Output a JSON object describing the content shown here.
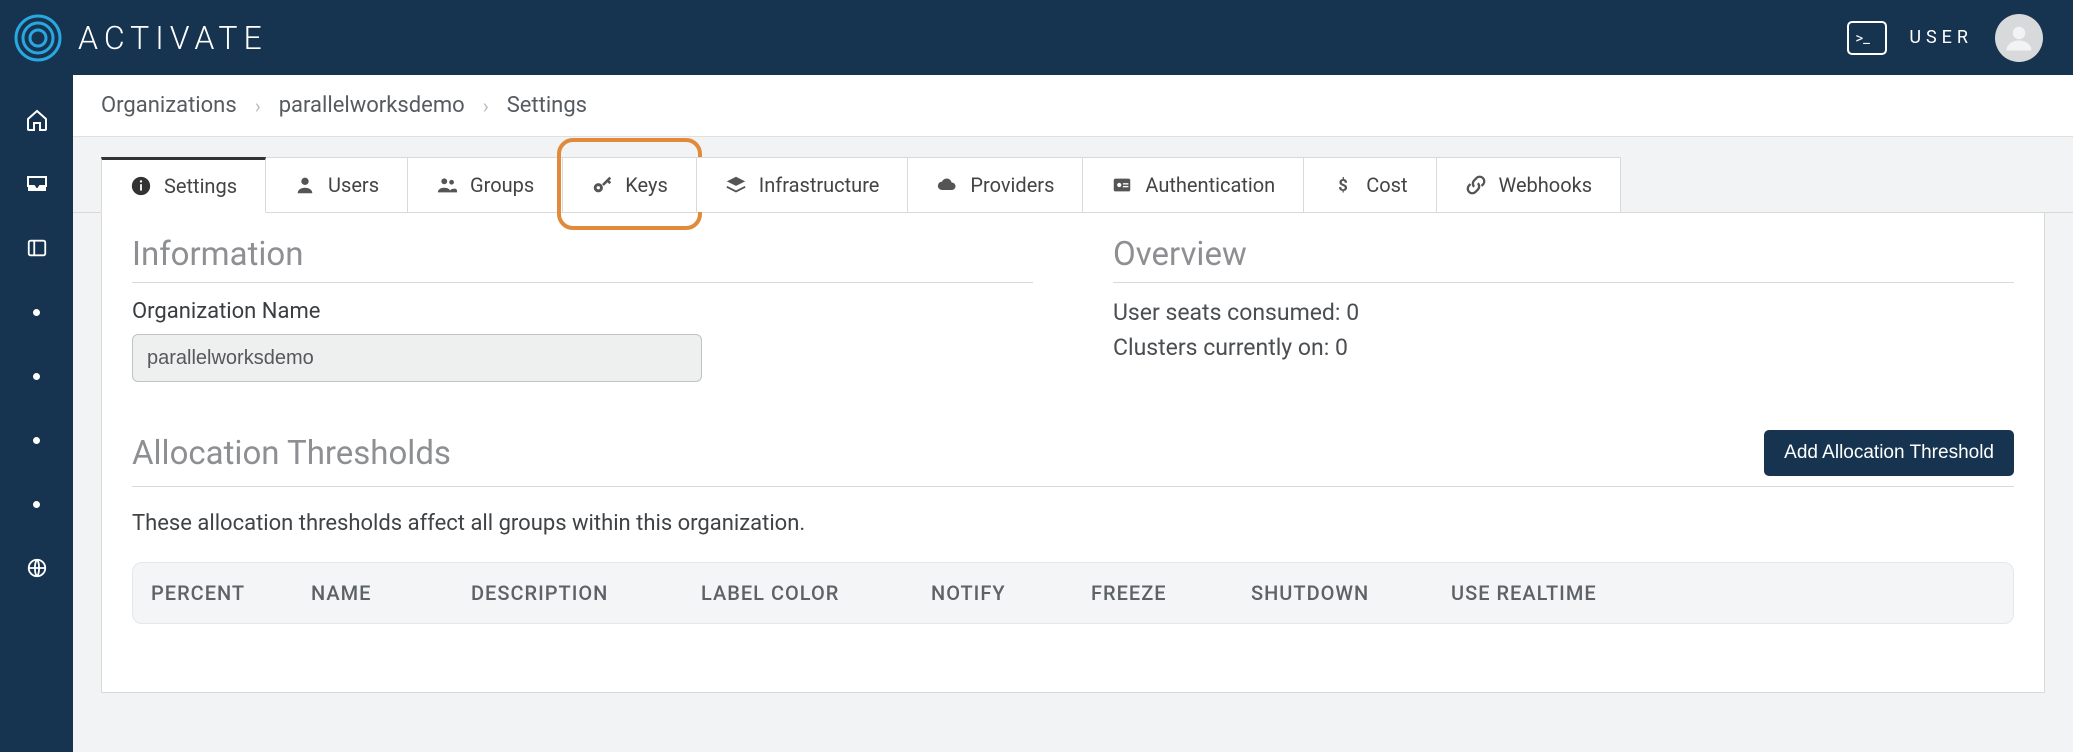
{
  "brand": {
    "name": "ACTIVATE"
  },
  "topbar": {
    "user_label": "USER",
    "terminal_glyph": ">_"
  },
  "breadcrumb": {
    "items": [
      "Organizations",
      "parallelworksdemo",
      "Settings"
    ]
  },
  "tabs": [
    {
      "label": "Settings",
      "icon": "info"
    },
    {
      "label": "Users",
      "icon": "user"
    },
    {
      "label": "Groups",
      "icon": "group"
    },
    {
      "label": "Keys",
      "icon": "key"
    },
    {
      "label": "Infrastructure",
      "icon": "layers"
    },
    {
      "label": "Providers",
      "icon": "cloud"
    },
    {
      "label": "Authentication",
      "icon": "badge"
    },
    {
      "label": "Cost",
      "icon": "dollar"
    },
    {
      "label": "Webhooks",
      "icon": "link"
    }
  ],
  "active_tab_index": 0,
  "highlighted_tab_index": 3,
  "info": {
    "heading": "Information",
    "org_name_label": "Organization Name",
    "org_name_value": "parallelworksdemo"
  },
  "overview": {
    "heading": "Overview",
    "seats_label": "User seats consumed:",
    "seats_value": "0",
    "clusters_label": "Clusters currently on:",
    "clusters_value": "0"
  },
  "alloc": {
    "heading": "Allocation Thresholds",
    "add_button": "Add Allocation Threshold",
    "description": "These allocation thresholds affect all groups within this organization.",
    "columns": [
      "PERCENT",
      "NAME",
      "DESCRIPTION",
      "LABEL COLOR",
      "NOTIFY",
      "FREEZE",
      "SHUTDOWN",
      "USE REALTIME"
    ]
  }
}
